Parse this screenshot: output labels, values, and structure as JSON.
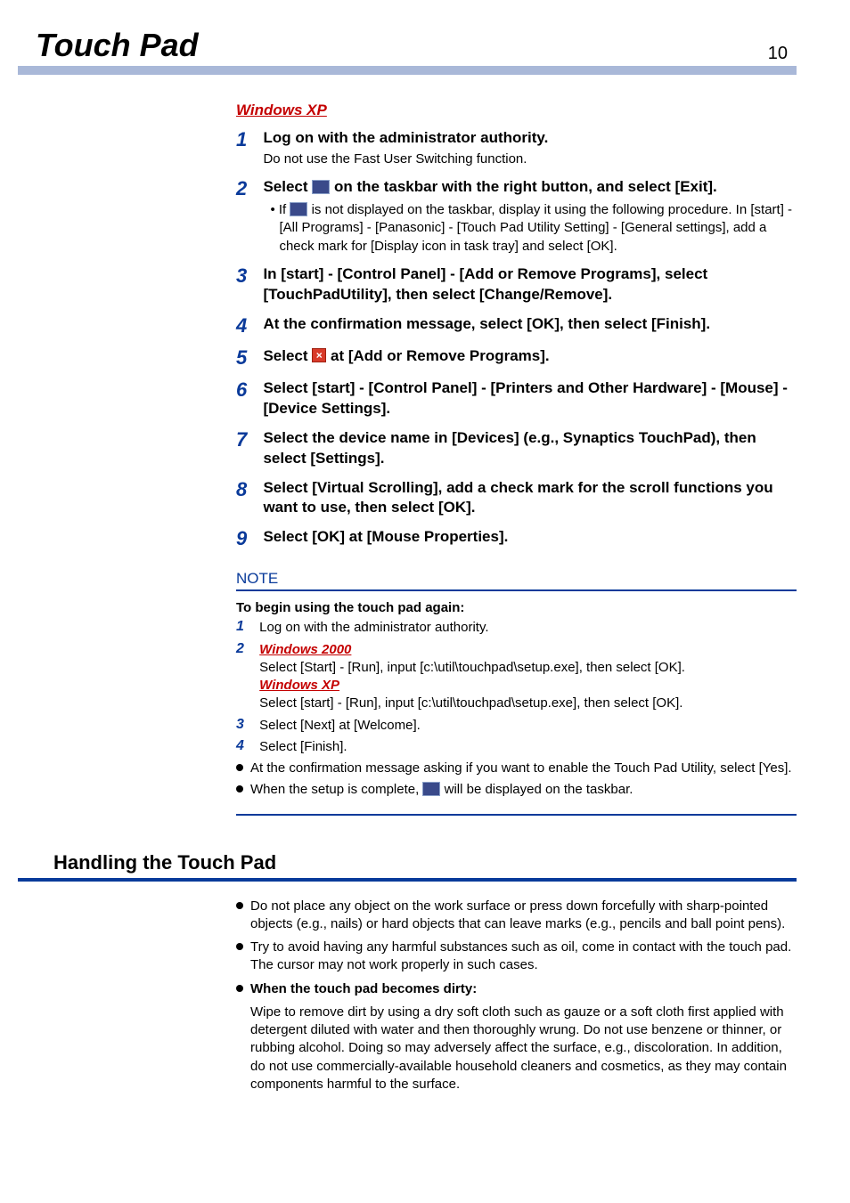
{
  "header": {
    "title": "Touch Pad",
    "page_number": "10"
  },
  "os_xp": "Windows XP",
  "os_2000": "Windows 2000",
  "steps": {
    "s1": {
      "title": "Log on with the administrator authority.",
      "sub": "Do not use the Fast User Switching function."
    },
    "s2": {
      "title_a": "Select",
      "title_b": "on the taskbar with the right button, and select [Exit].",
      "bullet_a": "If",
      "bullet_b": "is not displayed on the taskbar, display it using the following procedure. In [start] - [All Programs] - [Panasonic] - [Touch Pad Utility Setting] - [General settings], add a check mark for [Display icon in task tray] and select [OK]."
    },
    "s3": {
      "title": "In [start] - [Control Panel] - [Add or Remove Programs], select [TouchPadUtility], then select [Change/Remove]."
    },
    "s4": {
      "title": "At the confirmation message, select [OK], then select [Finish]."
    },
    "s5": {
      "title_a": "Select",
      "title_b": "at [Add or Remove Programs]."
    },
    "s6": {
      "title": "Select [start] - [Control Panel] - [Printers and Other Hardware] - [Mouse] - [Device Settings]."
    },
    "s7": {
      "title": "Select the device name in [Devices] (e.g., Synaptics TouchPad), then select [Settings]."
    },
    "s8": {
      "title": "Select [Virtual Scrolling], add a check mark for the scroll functions you want to use, then select [OK]."
    },
    "s9": {
      "title": "Select [OK] at [Mouse Properties]."
    }
  },
  "note": {
    "heading": "NOTE",
    "lead": "To begin using the touch pad again:",
    "n1": "Log on with the administrator authority.",
    "n2a": "Select [Start] - [Run], input [c:\\util\\touchpad\\setup.exe], then select [OK].",
    "n2b": "Select [start] - [Run], input [c:\\util\\touchpad\\setup.exe], then select [OK].",
    "n3": "Select [Next] at [Welcome].",
    "n4": "Select [Finish].",
    "b1": "At the confirmation message asking if you want to enable the Touch Pad Utility, select [Yes].",
    "b2a": "When the setup is complete,",
    "b2b": "will be displayed on the taskbar."
  },
  "section": {
    "title": "Handling the Touch Pad",
    "h1": "Do not place any object on the work surface or press down forcefully with sharp-pointed objects (e.g., nails) or hard objects that can leave marks (e.g., pencils and ball point pens).",
    "h2": "Try to avoid having any harmful substances such as oil, come in contact with the touch pad. The cursor may not work properly in such cases.",
    "h3_title": "When the touch pad becomes dirty:",
    "h3_body": "Wipe to remove dirt by using a dry soft cloth such as gauze or a soft cloth first applied with detergent diluted with water and then thoroughly wrung. Do not use benzene or thinner, or rubbing alcohol. Doing so may adversely affect the surface, e.g., discoloration. In addition, do not use commercially-available household cleaners and cosmetics, as they may contain components harmful to the surface."
  }
}
